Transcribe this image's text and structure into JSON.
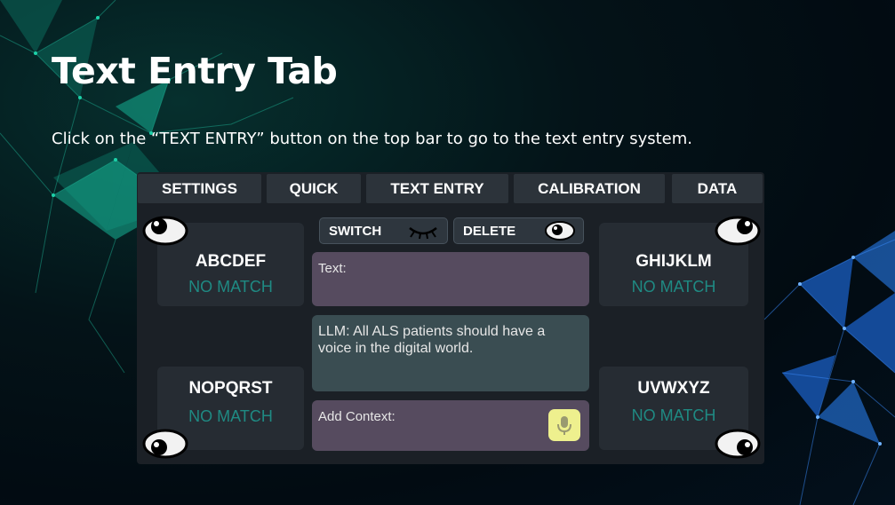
{
  "slide": {
    "title": "Text Entry Tab",
    "subtitle": "Click on the “TEXT ENTRY” button on the top bar to go to the text entry system."
  },
  "tabs": [
    {
      "label": "SETTINGS"
    },
    {
      "label": "QUICK"
    },
    {
      "label": "TEXT ENTRY"
    },
    {
      "label": "CALIBRATION"
    },
    {
      "label": "DATA"
    }
  ],
  "groups": [
    {
      "letters": "ABCDEF",
      "status": "NO MATCH"
    },
    {
      "letters": "GHIJKLM",
      "status": "NO MATCH"
    },
    {
      "letters": "NOPQRST",
      "status": "NO MATCH"
    },
    {
      "letters": "UVWXYZ",
      "status": "NO MATCH"
    }
  ],
  "controls": {
    "switch_label": "SWITCH",
    "delete_label": "DELETE"
  },
  "fields": {
    "text_label": "Text:",
    "llm_text": "LLM: All ALS patients should have a voice in the digital world.",
    "context_label": "Add Context:"
  },
  "icons": {
    "eye_open": "eye-open-icon",
    "eye_closed": "eye-closed-icon",
    "mic": "microphone-icon"
  },
  "colors": {
    "text_box": "#564b5f",
    "llm_box": "#3a4d52",
    "status_teal": "#1f8a83",
    "mic_button": "#eef08e"
  }
}
